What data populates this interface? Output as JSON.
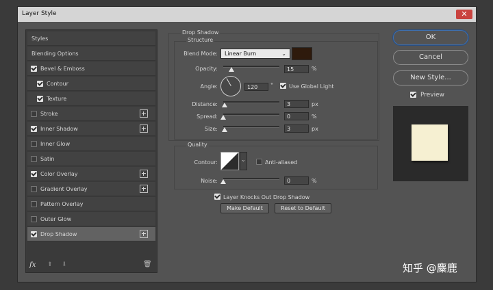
{
  "window": {
    "title": "Layer Style",
    "close_glyph": "✕"
  },
  "sidebar": {
    "items": [
      {
        "label": "Styles",
        "checkbox": null,
        "plus": false,
        "selected": false
      },
      {
        "label": "Blending Options",
        "checkbox": null,
        "plus": false,
        "selected": false
      },
      {
        "label": "Bevel & Emboss",
        "checkbox": true,
        "plus": false,
        "selected": false
      },
      {
        "label": "Contour",
        "checkbox": true,
        "plus": false,
        "selected": false,
        "indent": true
      },
      {
        "label": "Texture",
        "checkbox": true,
        "plus": false,
        "selected": false,
        "indent": true
      },
      {
        "label": "Stroke",
        "checkbox": false,
        "plus": true,
        "selected": false
      },
      {
        "label": "Inner Shadow",
        "checkbox": true,
        "plus": true,
        "selected": false
      },
      {
        "label": "Inner Glow",
        "checkbox": false,
        "plus": false,
        "selected": false
      },
      {
        "label": "Satin",
        "checkbox": false,
        "plus": false,
        "selected": false
      },
      {
        "label": "Color Overlay",
        "checkbox": true,
        "plus": true,
        "selected": false
      },
      {
        "label": "Gradient Overlay",
        "checkbox": false,
        "plus": true,
        "selected": false
      },
      {
        "label": "Pattern Overlay",
        "checkbox": false,
        "plus": false,
        "selected": false
      },
      {
        "label": "Outer Glow",
        "checkbox": false,
        "plus": false,
        "selected": false
      },
      {
        "label": "Drop Shadow",
        "checkbox": true,
        "plus": true,
        "selected": true
      }
    ],
    "fx_label": "fx",
    "up_glyph": "⬆",
    "down_glyph": "⬇",
    "trash_glyph": "🗑"
  },
  "drop_shadow": {
    "section_title": "Drop Shadow",
    "structure_title": "Structure",
    "blend_mode_label": "Blend Mode:",
    "blend_mode_value": "Linear Burn",
    "shadow_color": "#2e1a0c",
    "opacity_label": "Opacity:",
    "opacity_value": "15",
    "opacity_unit": "%",
    "opacity_level": 0.15,
    "angle_label": "Angle:",
    "angle_value": "120",
    "angle_unit": "°",
    "use_global_light_label": "Use Global Light",
    "use_global_light_checked": true,
    "distance_label": "Distance:",
    "distance_value": "3",
    "distance_unit": "px",
    "distance_level": 0.03,
    "spread_label": "Spread:",
    "spread_value": "0",
    "spread_unit": "%",
    "spread_level": 0,
    "size_label": "Size:",
    "size_value": "3",
    "size_unit": "px",
    "size_level": 0.03
  },
  "quality": {
    "title": "Quality",
    "contour_label": "Contour:",
    "anti_aliased_label": "Anti-aliased",
    "anti_aliased_checked": false,
    "noise_label": "Noise:",
    "noise_value": "0",
    "noise_unit": "%",
    "noise_level": 0,
    "knockout_label": "Layer Knocks Out Drop Shadow",
    "knockout_checked": true,
    "make_default_label": "Make Default",
    "reset_default_label": "Reset to Default"
  },
  "buttons": {
    "ok": "OK",
    "cancel": "Cancel",
    "new_style": "New Style..."
  },
  "preview": {
    "label": "Preview",
    "checked": true,
    "swatch_color": "#f6f0d2"
  },
  "watermark": "知乎 @麋鹿"
}
